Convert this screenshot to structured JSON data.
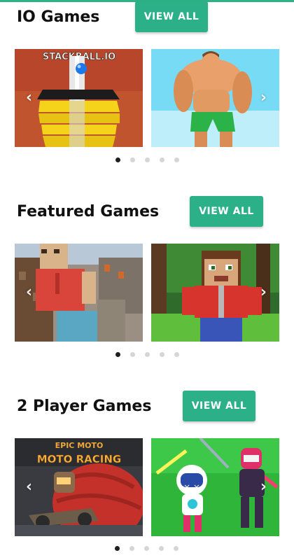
{
  "sections": [
    {
      "title": "IO Games",
      "button_label": "VIEW ALL",
      "cards": [
        {
          "image_text": "STACKBALL.IO"
        },
        {
          "image_text": ""
        }
      ],
      "prev_arrow": "‹",
      "next_arrow": "›",
      "dot_count": 5,
      "active_dot": 0
    },
    {
      "title": "Featured Games",
      "button_label": "VIEW ALL",
      "cards": [
        {
          "image_text": ""
        },
        {
          "image_text": ""
        }
      ],
      "prev_arrow": "‹",
      "next_arrow": "›",
      "dot_count": 5,
      "active_dot": 0
    },
    {
      "title": "2 Player Games",
      "button_label": "VIEW ALL",
      "cards": [
        {
          "image_text_1": "EPIC MOTO",
          "image_text_2": "MOTO RACING"
        },
        {
          "image_text": ""
        }
      ],
      "prev_arrow": "‹",
      "next_arrow": "›",
      "dot_count": 5,
      "active_dot": 0
    }
  ],
  "colors": {
    "accent": "#2bb087",
    "dot_active": "#1f1f1f",
    "dot_inactive": "#d6d6d6"
  }
}
